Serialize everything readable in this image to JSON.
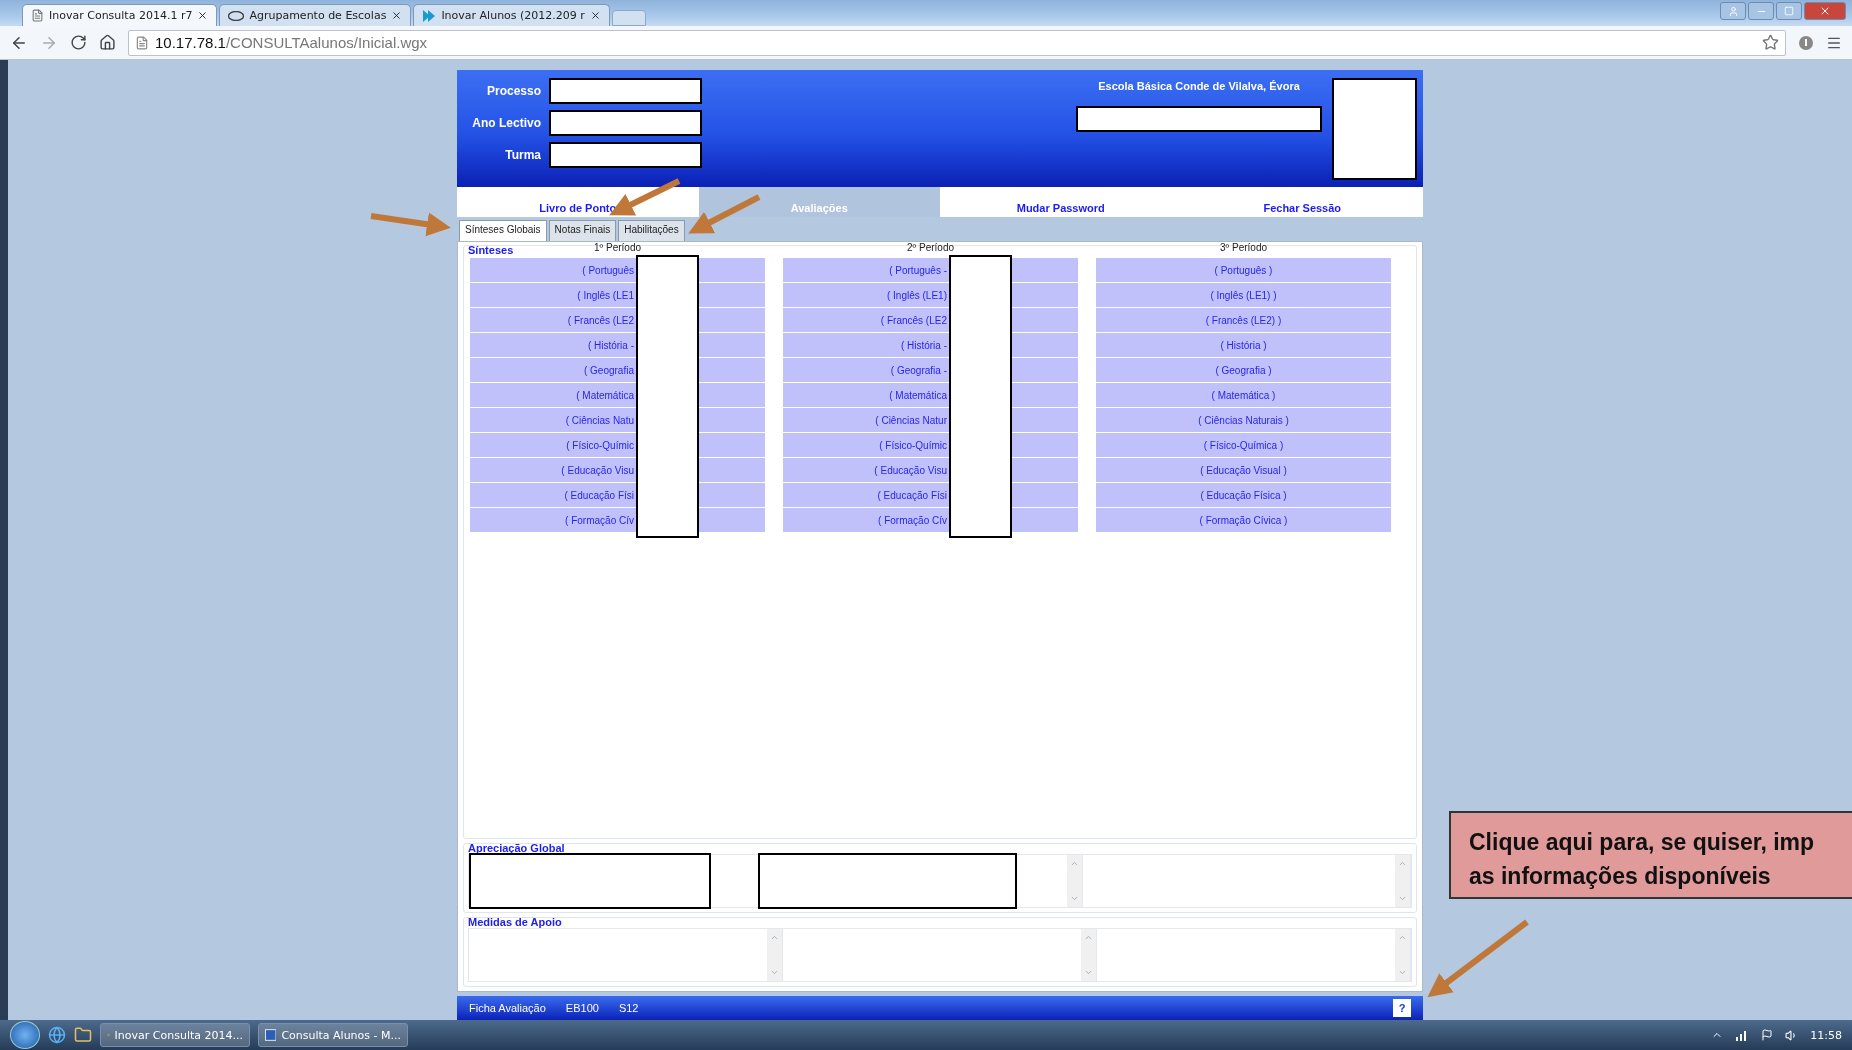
{
  "browser": {
    "tabs": [
      {
        "title": "Inovar Consulta 2014.1 r7",
        "selected": true,
        "kind": "page"
      },
      {
        "title": "Agrupamento de Escolas",
        "selected": false,
        "kind": "school"
      },
      {
        "title": "Inovar Alunos (2012.209 r",
        "selected": false,
        "kind": "app"
      }
    ],
    "url_host": "10.17.78.1",
    "url_path": "/CONSULTAalunos/Inicial.wgx"
  },
  "header": {
    "fields": [
      {
        "label": "Processo"
      },
      {
        "label": "Ano Lectivo"
      },
      {
        "label": "Turma"
      }
    ],
    "school": "Escola Básica Conde de Vilalva, Évora"
  },
  "nav": [
    {
      "label": "Livro de Ponto",
      "selected": false
    },
    {
      "label": "Avaliações",
      "selected": true
    },
    {
      "label": "Mudar Password",
      "selected": false
    },
    {
      "label": "Fechar Sessão",
      "selected": false
    }
  ],
  "subtabs": [
    {
      "label": "Sínteses Globais",
      "selected": true
    },
    {
      "label": "Notas Finais",
      "selected": false
    },
    {
      "label": "Habilitações",
      "selected": false
    }
  ],
  "sinteses": {
    "title": "Sínteses",
    "periods": [
      {
        "title": "1º Período",
        "redacted": true,
        "subjects": [
          "( Português",
          "( Inglês (LE1",
          "( Francês (LE2",
          "( História -",
          "( Geografia",
          "( Matemática",
          "( Ciências Natu",
          "( Físico-Químic",
          "( Educação Visu",
          "( Educação Físi",
          "( Formação Cív"
        ]
      },
      {
        "title": "2º Período",
        "redacted": true,
        "subjects": [
          "( Português -",
          "( Inglês (LE1)",
          "( Francês (LE2",
          "( História -",
          "( Geografia -",
          "( Matemática",
          "( Ciências Natur",
          "( Físico-Químic",
          "( Educação Visu",
          "( Educação Físi",
          "( Formação Cív"
        ]
      },
      {
        "title": "3º Período",
        "redacted": false,
        "subjects": [
          "( Português )",
          "( Inglês (LE1) )",
          "( Francês (LE2) )",
          "( História )",
          "( Geografia )",
          "( Matemática )",
          "( Ciências Naturais )",
          "( Físico-Química )",
          "( Educação Visual )",
          "( Educação Física )",
          "( Formação Cívica )"
        ]
      }
    ]
  },
  "apreciacao": {
    "title": "Apreciação Global"
  },
  "medidas": {
    "title": "Medidas de Apoio"
  },
  "status_bar": {
    "items": [
      "Ficha Avaliação",
      "EB100",
      "S12"
    ],
    "help": "?"
  },
  "callout": {
    "lines": [
      "Clique aqui para, se quiser, imp",
      "as informações disponíveis"
    ]
  },
  "taskbar": {
    "buttons": [
      {
        "label": "Inovar Consulta 2014...",
        "kind": "browser"
      },
      {
        "label": "Consulta Alunos - M...",
        "kind": "word"
      }
    ],
    "clock": "11:58"
  }
}
